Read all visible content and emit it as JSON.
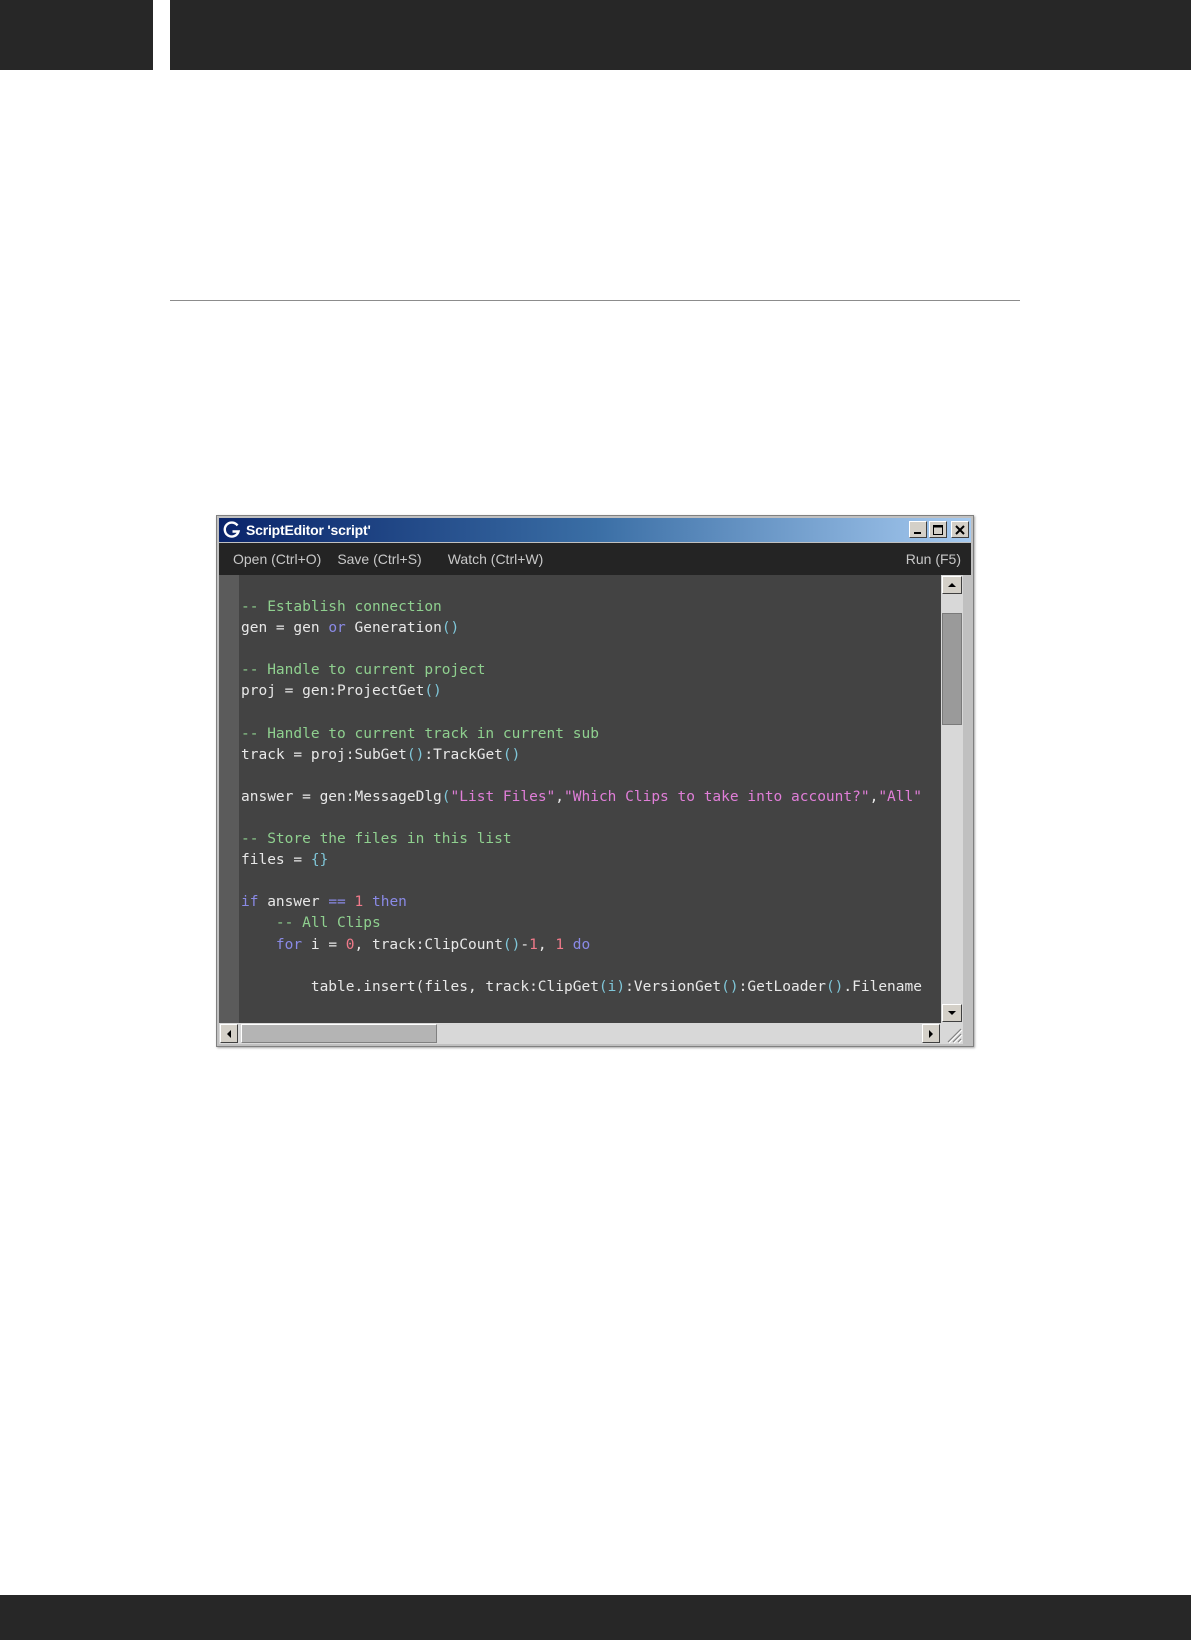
{
  "window": {
    "title": "ScriptEditor 'script'",
    "app_icon": "g-logo-icon"
  },
  "toolbar": {
    "open_label": "Open (Ctrl+O)",
    "save_label": "Save (Ctrl+S)",
    "watch_label": "Watch (Ctrl+W)",
    "run_label": "Run (F5)"
  },
  "colors": {
    "titlebar_start": "#0a246a",
    "titlebar_end": "#a6caf0",
    "editor_bg": "#434343",
    "comment": "#8fd08f",
    "keyword": "#8a8ae6",
    "string": "#e07ed8",
    "number": "#f07a8a"
  },
  "code": {
    "lines": [
      [
        [
          "comment",
          "-- Establish connection"
        ]
      ],
      [
        [
          "text",
          "gen = gen "
        ],
        [
          "kw",
          "or"
        ],
        [
          "text",
          " Generation"
        ],
        [
          "punc",
          "()"
        ]
      ],
      [],
      [
        [
          "comment",
          "-- Handle to current project"
        ]
      ],
      [
        [
          "text",
          "proj = gen:ProjectGet"
        ],
        [
          "punc",
          "()"
        ]
      ],
      [],
      [
        [
          "comment",
          "-- Handle to current track in current sub"
        ]
      ],
      [
        [
          "text",
          "track = proj:SubGet"
        ],
        [
          "punc",
          "()"
        ],
        [
          "text",
          ":TrackGet"
        ],
        [
          "punc",
          "()"
        ]
      ],
      [],
      [
        [
          "text",
          "answer = gen:MessageDlg"
        ],
        [
          "punc",
          "("
        ],
        [
          "str",
          "\"List Files\""
        ],
        [
          "text",
          ","
        ],
        [
          "str",
          "\"Which Clips to take into account?\""
        ],
        [
          "text",
          ","
        ],
        [
          "str",
          "\"All\""
        ]
      ],
      [],
      [
        [
          "comment",
          "-- Store the files in this list"
        ]
      ],
      [
        [
          "text",
          "files = "
        ],
        [
          "punc",
          "{}"
        ]
      ],
      [],
      [
        [
          "kw",
          "if"
        ],
        [
          "text",
          " answer "
        ],
        [
          "kw",
          "=="
        ],
        [
          "text",
          " "
        ],
        [
          "num",
          "1"
        ],
        [
          "text",
          " "
        ],
        [
          "kw",
          "then"
        ]
      ],
      [
        [
          "text",
          "    "
        ],
        [
          "comment",
          "-- All Clips"
        ]
      ],
      [
        [
          "text",
          "    "
        ],
        [
          "kw",
          "for"
        ],
        [
          "text",
          " i = "
        ],
        [
          "num",
          "0"
        ],
        [
          "text",
          ", track:ClipCount"
        ],
        [
          "punc",
          "()"
        ],
        [
          "text",
          "-"
        ],
        [
          "num",
          "1"
        ],
        [
          "text",
          ", "
        ],
        [
          "num",
          "1"
        ],
        [
          "text",
          " "
        ],
        [
          "kw",
          "do"
        ]
      ],
      [],
      [
        [
          "text",
          "        table.insert(files, track:ClipGet"
        ],
        [
          "punc",
          "(i)"
        ],
        [
          "text",
          ":VersionGet"
        ],
        [
          "punc",
          "()"
        ],
        [
          "text",
          ":GetLoader"
        ],
        [
          "punc",
          "()"
        ],
        [
          "text",
          ".Filename"
        ]
      ]
    ]
  }
}
